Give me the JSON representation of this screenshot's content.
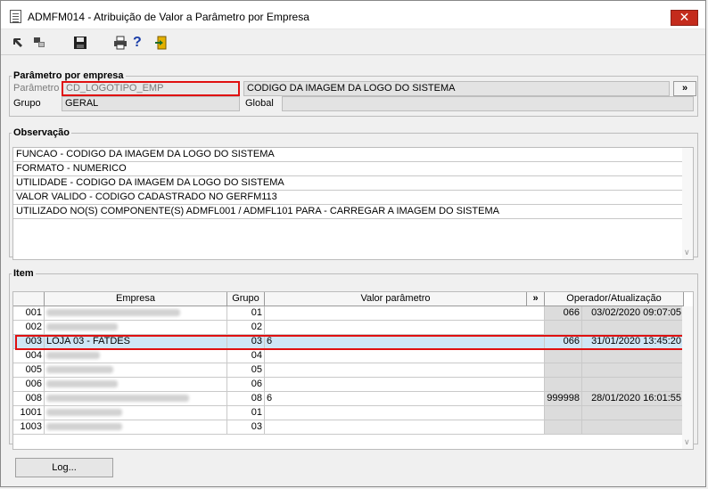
{
  "window": {
    "title": "ADMFM014 - Atribuição de Valor a Parâmetro por Empresa",
    "close_label": "✕"
  },
  "toolbar": {
    "help_label": "?"
  },
  "param_section": {
    "legend": "Parâmetro por empresa",
    "parametro_label": "Parâmetro",
    "parametro_value": "CD_LOGOTIPO_EMP",
    "parametro_desc": "CODIGO DA IMAGEM DA LOGO DO SISTEMA",
    "more_label": "»",
    "grupo_label": "Grupo",
    "grupo_value": "GERAL",
    "global_label": "Global",
    "global_value": ""
  },
  "obs_section": {
    "legend": "Observação",
    "lines": [
      "FUNCAO - CODIGO DA IMAGEM DA LOGO DO SISTEMA",
      "FORMATO - NUMERICO",
      "UTILIDADE - CODIGO DA IMAGEM DA LOGO DO SISTEMA",
      "VALOR VALIDO - CODIGO CADASTRADO NO GERFM113",
      "UTILIZADO NO(S) COMPONENTE(S) ADMFL001 / ADMFL101  PARA  - CARREGAR A IMAGEM DO SISTEMA"
    ]
  },
  "item_section": {
    "legend": "Item",
    "headers": {
      "empresa": "Empresa",
      "grupo": "Grupo",
      "valor": "Valor parâmetro",
      "more": "»",
      "operador": "Operador/Atualização"
    },
    "rows": [
      {
        "code": "001",
        "empresa": "",
        "grupo": "01",
        "valor": "",
        "operador": "066",
        "atualizacao": "03/02/2020 09:07:05"
      },
      {
        "code": "002",
        "empresa": "",
        "grupo": "02",
        "valor": "",
        "operador": "",
        "atualizacao": ""
      },
      {
        "code": "003",
        "empresa": "LOJA 03 - FATDES",
        "grupo": "03",
        "valor": "6",
        "operador": "066",
        "atualizacao": "31/01/2020 13:45:20"
      },
      {
        "code": "004",
        "empresa": "",
        "grupo": "04",
        "valor": "",
        "operador": "",
        "atualizacao": ""
      },
      {
        "code": "005",
        "empresa": "",
        "grupo": "05",
        "valor": "",
        "operador": "",
        "atualizacao": ""
      },
      {
        "code": "006",
        "empresa": "",
        "grupo": "06",
        "valor": "",
        "operador": "",
        "atualizacao": ""
      },
      {
        "code": "008",
        "empresa": "",
        "grupo": "08",
        "valor": "6",
        "operador": "999998",
        "atualizacao": "28/01/2020 16:01:55"
      },
      {
        "code": "1001",
        "empresa": "",
        "grupo": "01",
        "valor": "",
        "operador": "",
        "atualizacao": ""
      },
      {
        "code": "1003",
        "empresa": "",
        "grupo": "03",
        "valor": "",
        "operador": "",
        "atualizacao": ""
      }
    ]
  },
  "log_button": "Log..."
}
